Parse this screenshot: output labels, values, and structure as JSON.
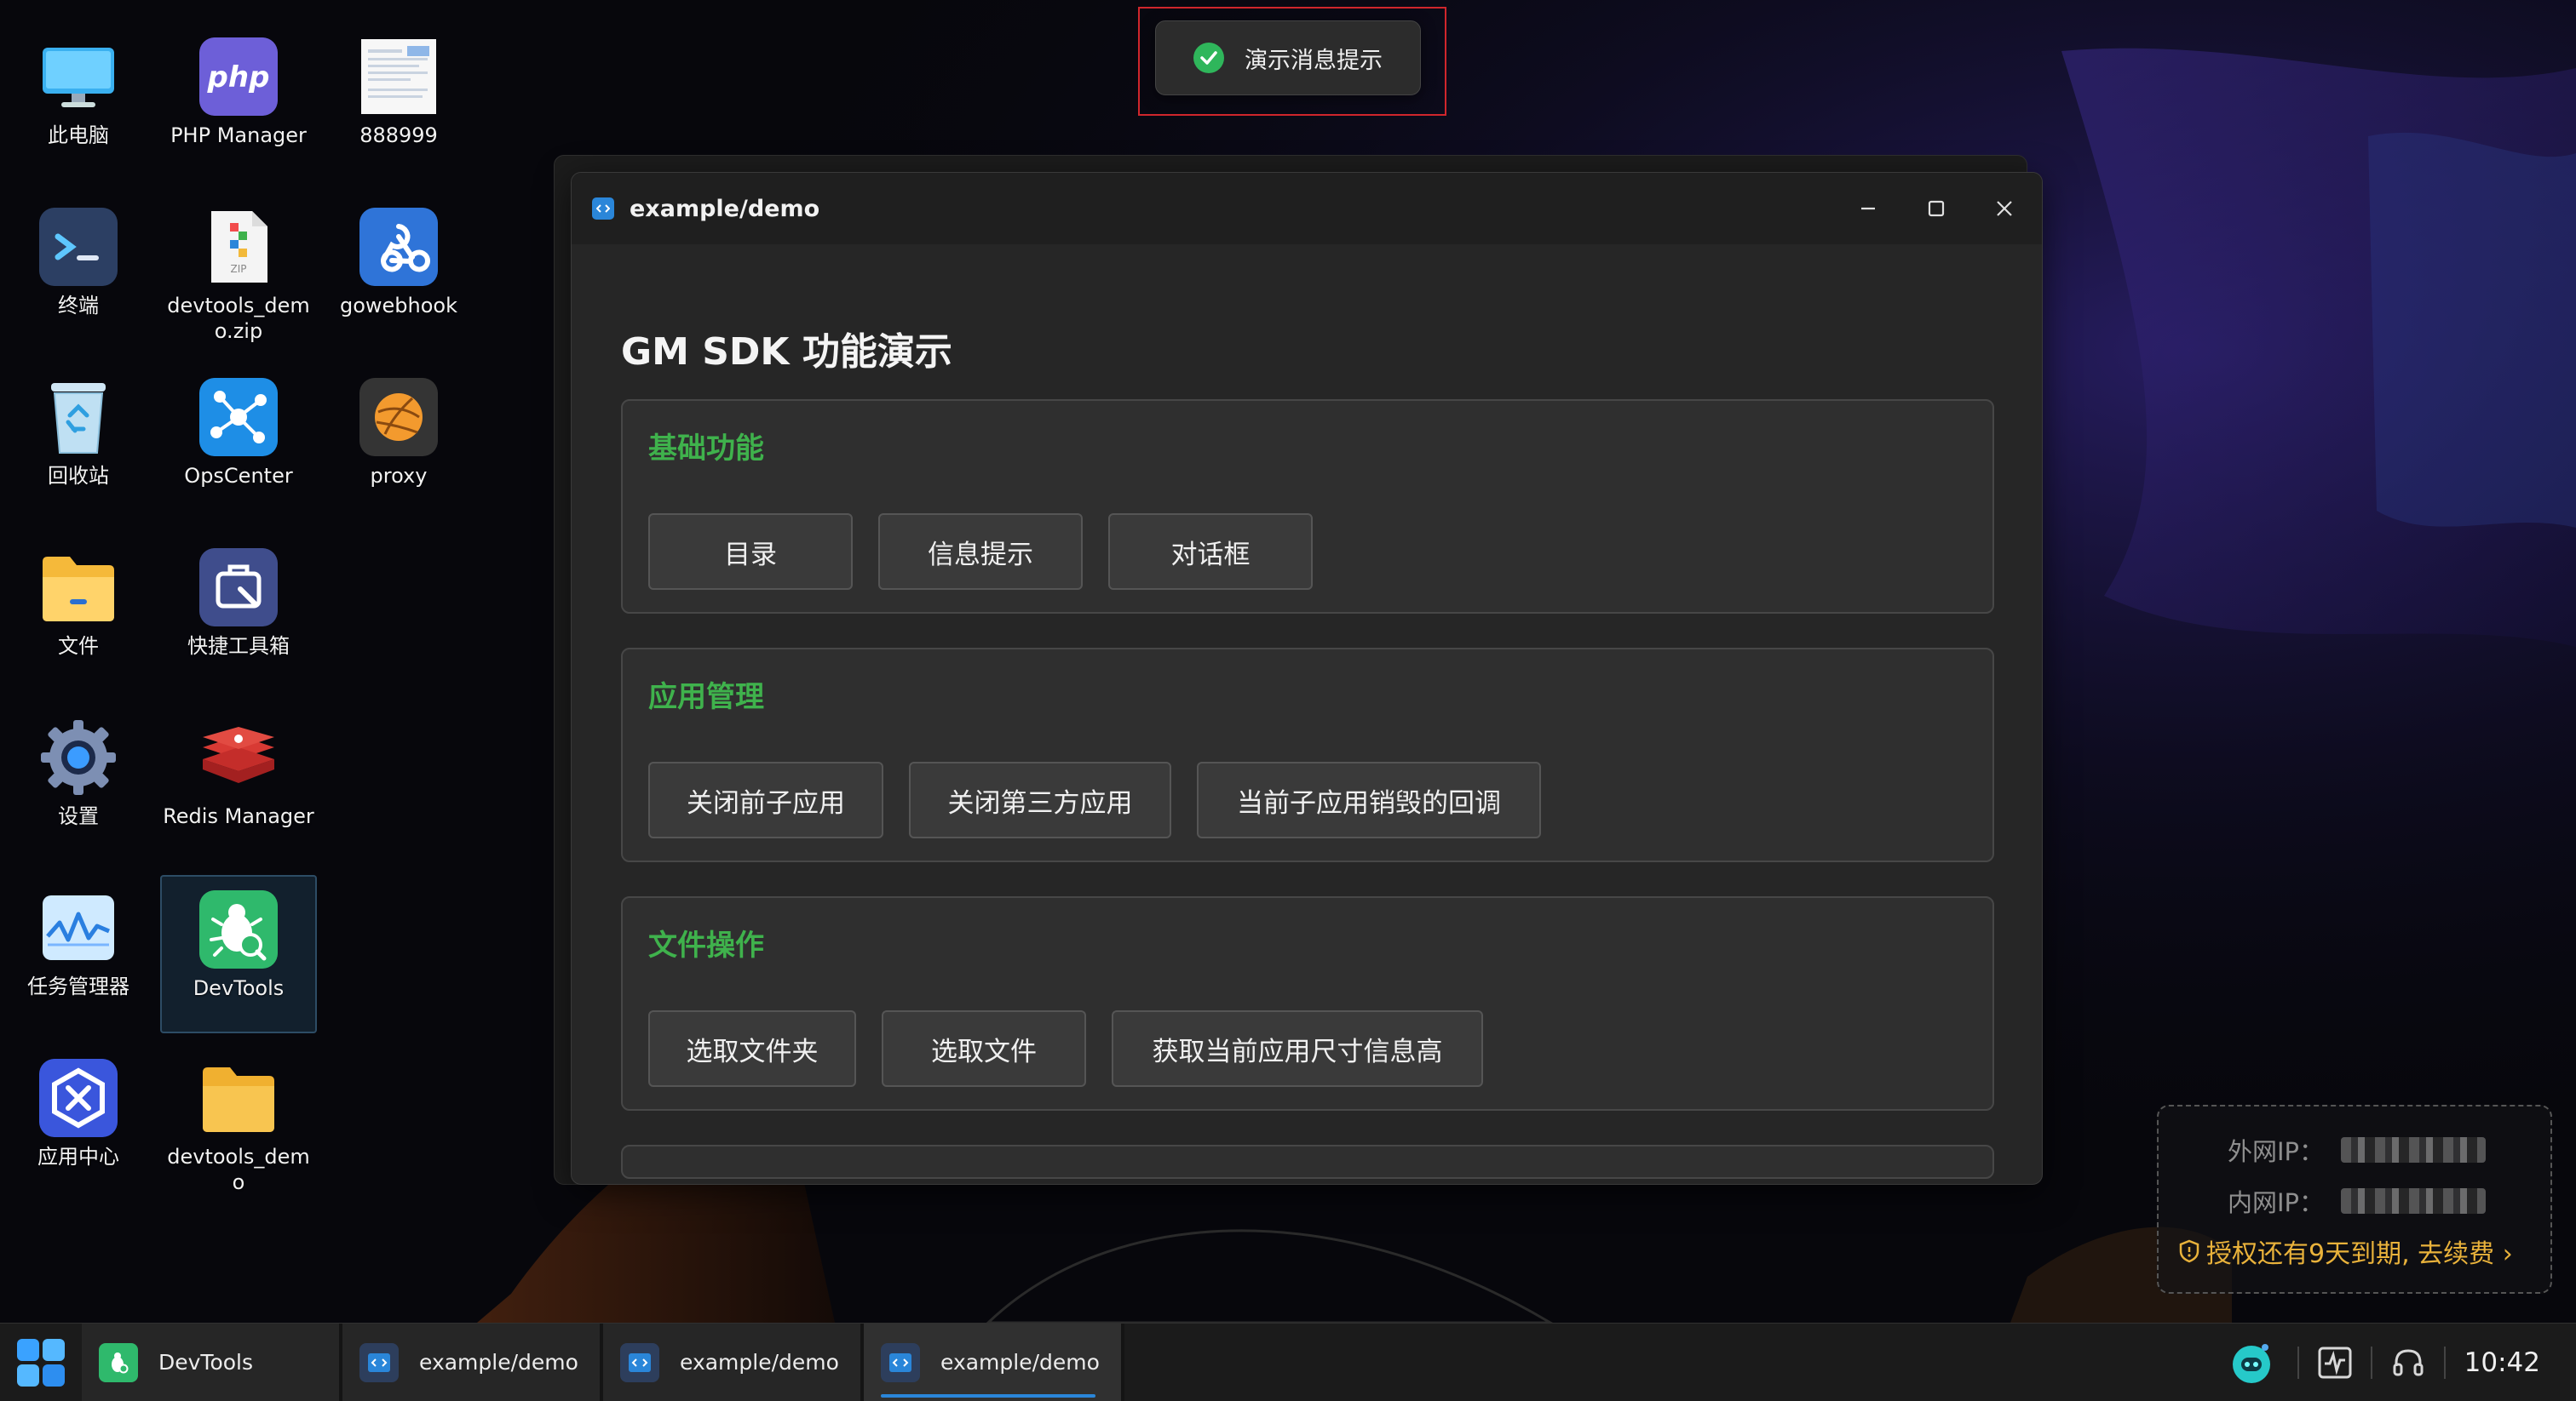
{
  "toast": {
    "message": "演示消息提示",
    "icon": "check-circle-icon"
  },
  "desktop": {
    "icons": [
      {
        "name": "此电脑",
        "icon": "monitor-icon"
      },
      {
        "name": "PHP Manager",
        "icon": "php-icon"
      },
      {
        "name": "888999",
        "icon": "document-thumbnail-icon"
      },
      {
        "name": "终端",
        "icon": "terminal-icon"
      },
      {
        "name": "devtools_demo.zip",
        "icon": "zip-file-icon"
      },
      {
        "name": "gowebhook",
        "icon": "webhook-icon"
      },
      {
        "name": "回收站",
        "icon": "recycle-bin-icon"
      },
      {
        "name": "OpsCenter",
        "icon": "network-nodes-icon"
      },
      {
        "name": "proxy",
        "icon": "ball-icon"
      },
      {
        "name": "文件",
        "icon": "folder-icon"
      },
      {
        "name": "快捷工具箱",
        "icon": "toolbox-icon"
      },
      {
        "name": "设置",
        "icon": "gear-icon"
      },
      {
        "name": "Redis Manager",
        "icon": "redis-icon"
      },
      {
        "name": "任务管理器",
        "icon": "activity-chart-icon"
      },
      {
        "name": "DevTools",
        "icon": "bug-icon"
      },
      {
        "name": "应用中心",
        "icon": "app-store-icon"
      },
      {
        "name": "devtools_demo",
        "icon": "folder-icon"
      }
    ]
  },
  "window": {
    "title": "example/demo",
    "heading": "GM SDK 功能演示",
    "sections": [
      {
        "title": "基础功能",
        "buttons": [
          "目录",
          "信息提示",
          "对话框"
        ]
      },
      {
        "title": "应用管理",
        "buttons": [
          "关闭前子应用",
          "关闭第三方应用",
          "当前子应用销毁的回调"
        ]
      },
      {
        "title": "文件操作",
        "buttons": [
          "选取文件夹",
          "选取文件",
          "获取当前应用尺寸信息高"
        ]
      }
    ]
  },
  "network": {
    "external_label": "外网IP：",
    "internal_label": "内网IP：",
    "license_text": "授权还有9天到期, 去续费 ›"
  },
  "taskbar": {
    "items": [
      {
        "label": "DevTools",
        "icon": "bug-icon",
        "active": false
      },
      {
        "label": "example/demo",
        "icon": "code-window-icon",
        "active": false
      },
      {
        "label": "example/demo",
        "icon": "code-window-icon",
        "active": false
      },
      {
        "label": "example/demo",
        "icon": "code-window-icon",
        "active": true
      }
    ],
    "clock": "10:42"
  },
  "colors": {
    "accent_green": "#3fb24c",
    "accent_blue": "#2a86d9",
    "license_orange": "#e9b23b",
    "toast_outline": "#d0262c"
  }
}
